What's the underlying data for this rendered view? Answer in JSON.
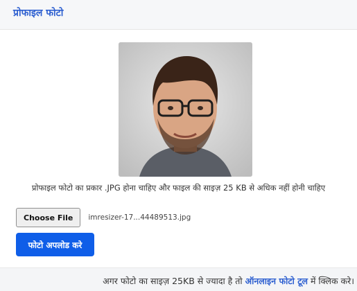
{
  "header": {
    "title": "प्रोफाइल फोटो"
  },
  "photo": {
    "alt": "profile photo"
  },
  "caption": "प्रोफाइल फोटो का प्रकार .JPG होना चाहिए और फाइल की साइज़ 25 KB से अधिक नहीं होनी चाहिए",
  "file_input": {
    "button_label": "Choose File",
    "file_name": "imresizer-17...44489513.jpg"
  },
  "upload_button": {
    "label": "फोटो अपलोड करे"
  },
  "footer": {
    "text_before": "अगर फोटो का साइज़ 25KB से ज्यादा है तो ",
    "link_text": "ऑनलाइन फोटो टूल",
    "text_after": " में क्लिक करे।"
  },
  "colors": {
    "accent": "#2d5fd0",
    "button": "#0f5ee8"
  }
}
